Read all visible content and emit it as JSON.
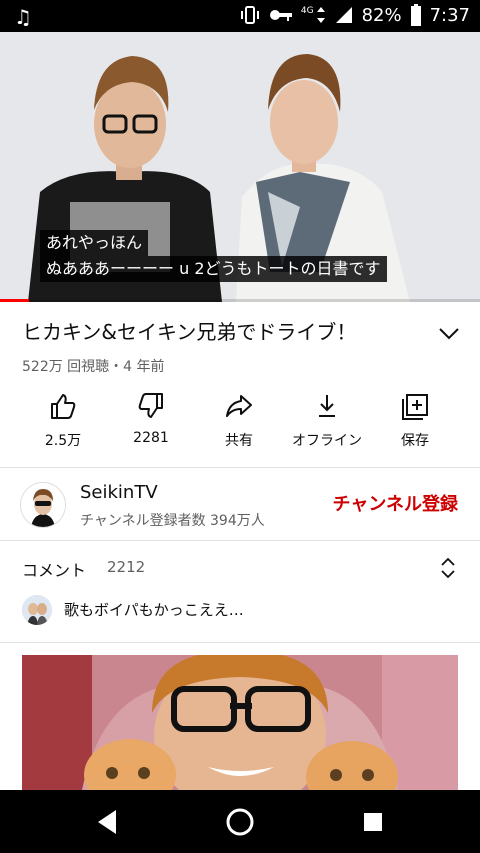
{
  "status_bar": {
    "network": "4G",
    "battery": "82%",
    "time": "7:37"
  },
  "video": {
    "subtitle_lines": [
      "あれやっほん",
      "ぬあああーーーー u 2どうもトートの日書です"
    ],
    "progress": 0.06
  },
  "title": "ヒカキン&セイキン兄弟でドライブ！",
  "meta": "522万 回視聴・4 年前",
  "actions": [
    {
      "label": "2.5万",
      "icon": "thumbs-up-icon"
    },
    {
      "label": "2281",
      "icon": "thumbs-down-icon"
    },
    {
      "label": "共有",
      "icon": "share-icon"
    },
    {
      "label": "オフライン",
      "icon": "download-icon"
    },
    {
      "label": "保存",
      "icon": "save-playlist-icon"
    }
  ],
  "channel": {
    "name": "SeikinTV",
    "subscribers": "チャンネル登録者数 394万人",
    "subscribe_label": "チャンネル登録"
  },
  "comments": {
    "header": "コメント",
    "count": "2212",
    "top_comment": "歌もボイパもかっこええ…"
  },
  "colors": {
    "accent_red": "#cc0000",
    "progress_red": "#ff0000",
    "text_secondary": "#606060"
  }
}
